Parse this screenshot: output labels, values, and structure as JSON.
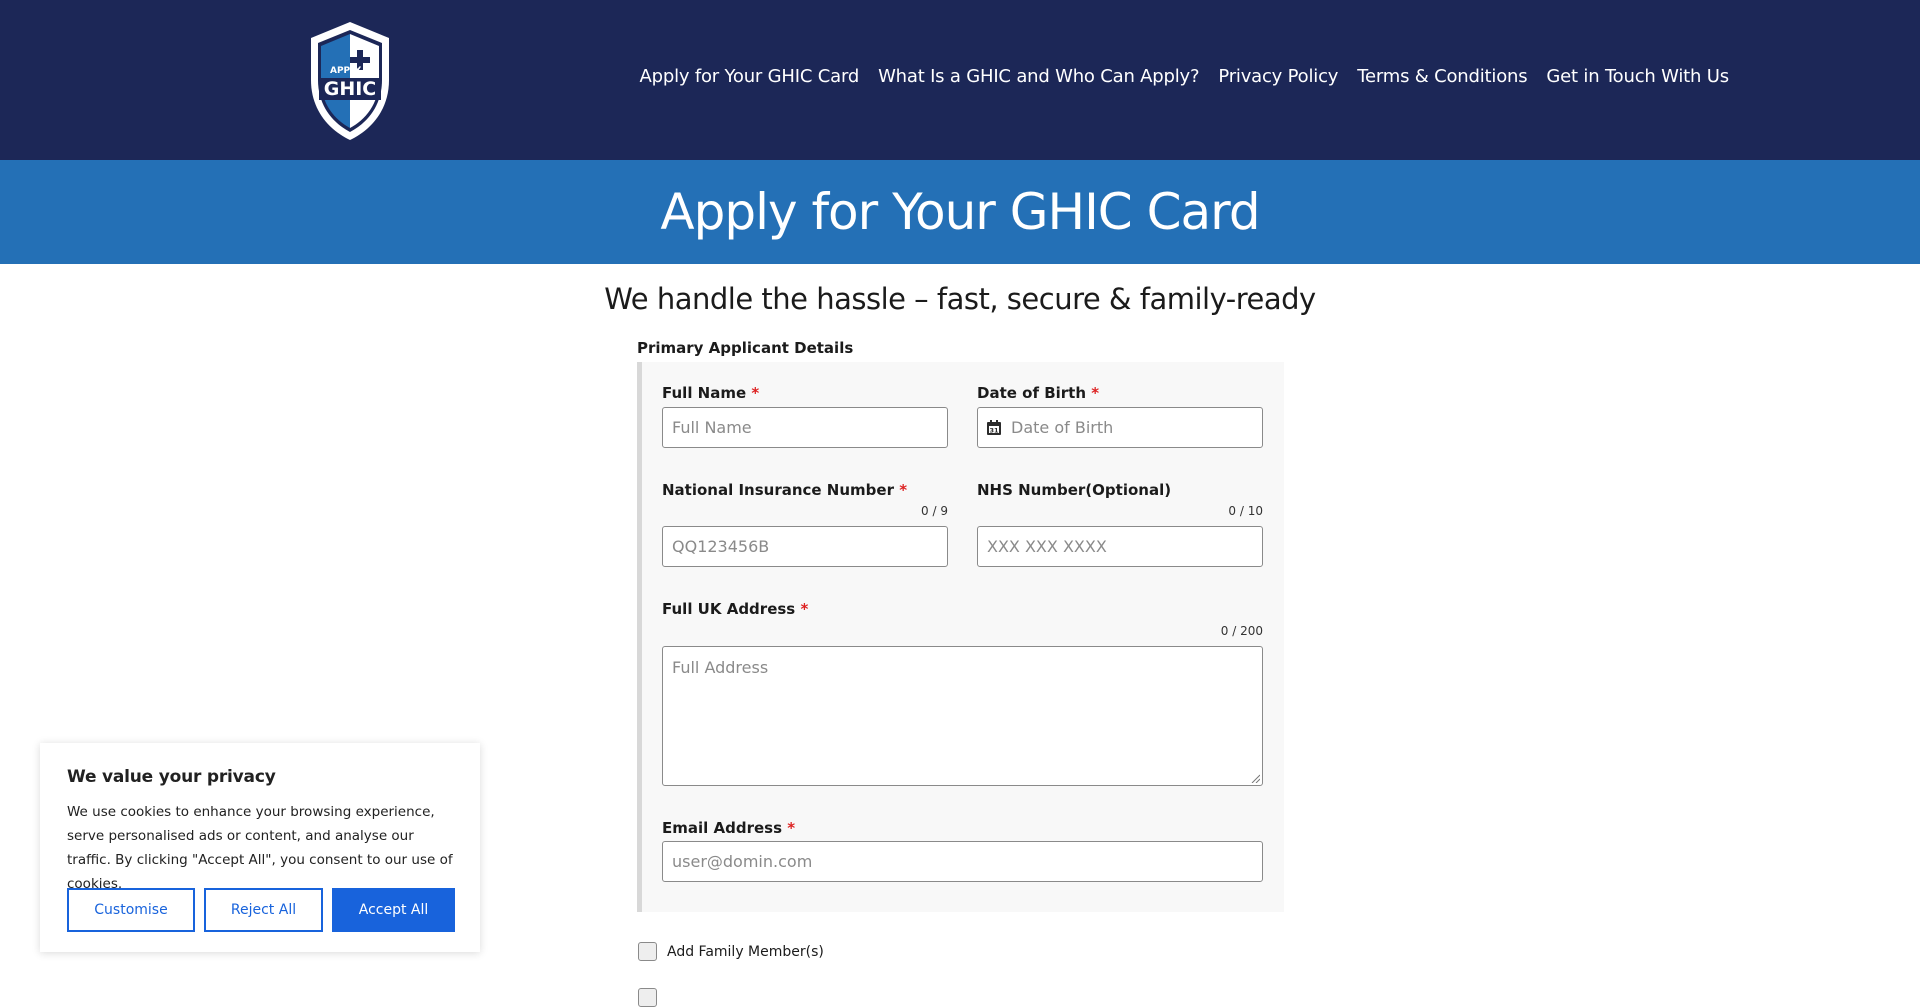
{
  "header": {
    "logo": {
      "text_top": "APPLY",
      "text_main": "GHIC"
    },
    "nav": [
      "Apply for Your GHIC Card",
      "What Is a GHIC and Who Can Apply?",
      "Privacy Policy",
      "Terms & Conditions",
      "Get in Touch With Us"
    ]
  },
  "hero": {
    "title": "Apply for Your GHIC Card"
  },
  "tagline": "We handle the hassle – fast, secure & family-ready",
  "form": {
    "section_label": "Primary Applicant Details",
    "required_marker": "*",
    "full_name": {
      "label": "Full Name",
      "placeholder": "Full Name"
    },
    "dob": {
      "label": "Date of Birth",
      "placeholder": "Date of Birth",
      "icon": "calendar-icon"
    },
    "nin": {
      "label": "National Insurance Number",
      "counter": "0 / 9",
      "placeholder": "QQ123456B"
    },
    "nhs": {
      "label": "NHS Number(Optional)",
      "counter": "0 / 10",
      "placeholder": "XXX XXX XXXX"
    },
    "address": {
      "label": "Full UK Address",
      "counter": "0 / 200",
      "placeholder": "Full Address"
    },
    "email": {
      "label": "Email Address",
      "placeholder": "user@domin.com"
    },
    "family": {
      "label": "Add Family Member(s)",
      "checked": false
    }
  },
  "cookie": {
    "title": "We value your privacy",
    "text": "We use cookies to enhance your browsing experience, serve personalised ads or content, and analyse our traffic. By clicking \"Accept All\", you consent to our use of cookies.",
    "customise": "Customise",
    "reject": "Reject All",
    "accept": "Accept All"
  },
  "colors": {
    "header_bg": "#1c2757",
    "hero_bg": "#2470b6",
    "cookie_accent": "#1863dc",
    "required": "#dd2222"
  }
}
